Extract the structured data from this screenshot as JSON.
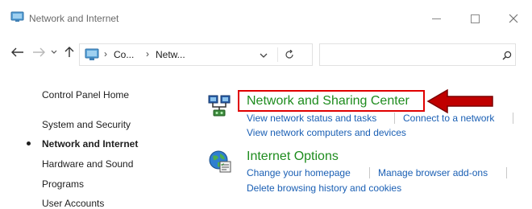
{
  "window": {
    "title": "Network and Internet",
    "controls": [
      "minimize",
      "maximize",
      "close"
    ]
  },
  "address_bar": {
    "crumbs": [
      "Co...",
      "Netw..."
    ],
    "separator": "›"
  },
  "search": {
    "placeholder": ""
  },
  "sidebar": {
    "items": [
      {
        "label": "Control Panel Home",
        "active": false
      },
      {
        "label": "System and Security",
        "active": false
      },
      {
        "label": "Network and Internet",
        "active": true
      },
      {
        "label": "Hardware and Sound",
        "active": false
      },
      {
        "label": "Programs",
        "active": false
      },
      {
        "label": "User Accounts",
        "active": false
      }
    ]
  },
  "categories": [
    {
      "title": "Network and Sharing Center",
      "icon": "network-sharing-icon",
      "tasks": [
        "View network status and tasks",
        "Connect to a network",
        "View network computers and devices"
      ]
    },
    {
      "title": "Internet Options",
      "icon": "internet-options-icon",
      "tasks": [
        "Change your homepage",
        "Manage browser add-ons",
        "Delete browsing history and cookies"
      ]
    }
  ],
  "annotation": {
    "highlight_color": "#e00000",
    "arrow_color": "#c00000"
  },
  "colors": {
    "category_title": "#1e8c1e",
    "task_link": "#1a5fb4"
  }
}
